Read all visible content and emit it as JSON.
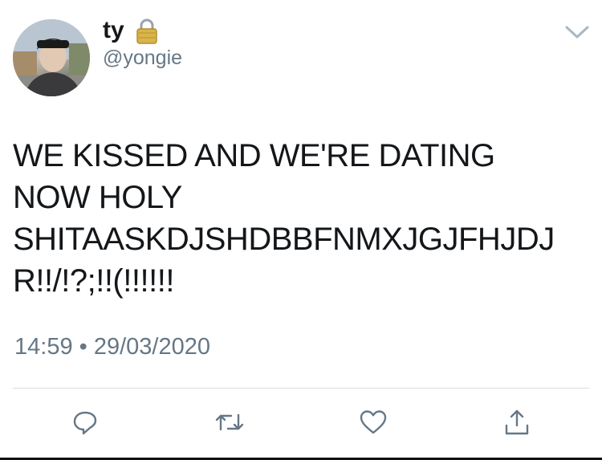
{
  "user": {
    "display_name": "ty",
    "handle": "@yongie",
    "locked": true
  },
  "tweet": {
    "text_lines": [
      "WE KISSED AND WE'RE DATING",
      "NOW HOLY",
      "SHITAASKDJSHDBBFNMXJGJFHJDJ",
      "R!!/!?;!!(!!!!!!"
    ],
    "timestamp": "14:59 • 29/03/2020"
  },
  "icons": {
    "lock": "lock-icon",
    "menu": "chevron-down-icon",
    "reply": "reply-icon",
    "retweet": "retweet-icon",
    "like": "heart-icon",
    "share": "share-icon"
  },
  "colors": {
    "text": "#14171a",
    "secondary": "#657786",
    "icon": "#657786",
    "divider": "#d6dde3",
    "background": "#ffffff"
  }
}
